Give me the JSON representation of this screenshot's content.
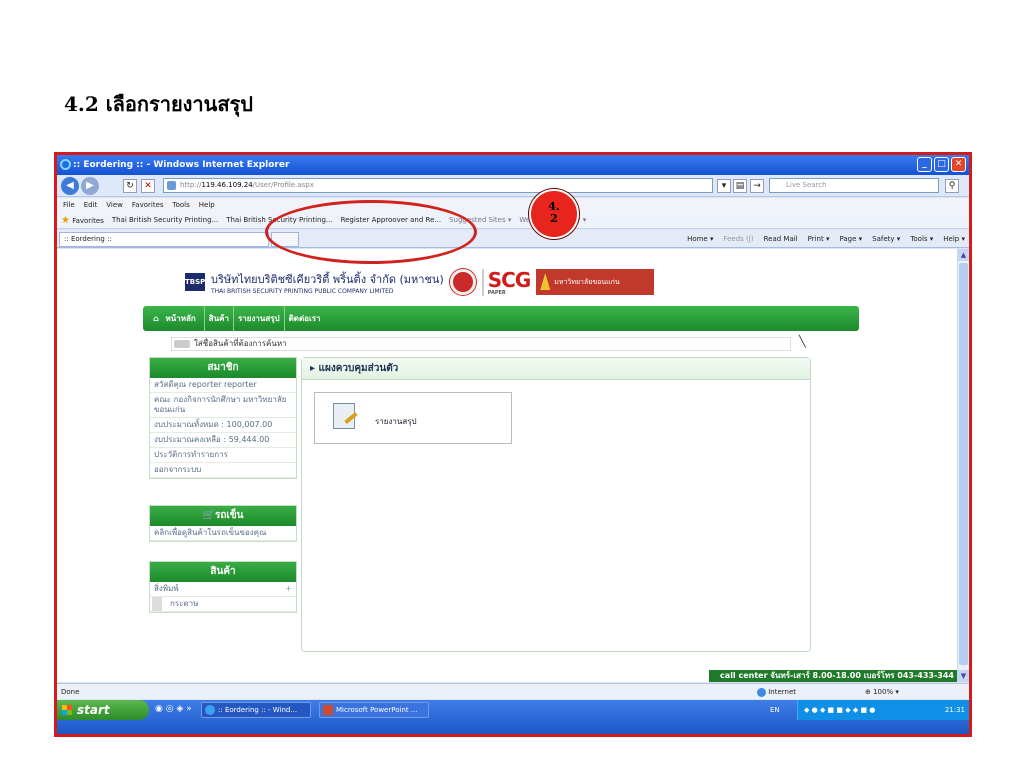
{
  "slide_title": "4.2  เลือกรายงานสรุป",
  "window": {
    "title": ":: Eordering :: - Windows Internet Explorer",
    "minimize": "_",
    "maximize": "□",
    "close": "✕"
  },
  "addressbar": {
    "url_prefix": "http://",
    "url_host": "119.46.109.24",
    "url_path": "/User/Profile.aspx",
    "search_placeholder": "Live Search"
  },
  "menu": [
    "File",
    "Edit",
    "View",
    "Favorites",
    "Tools",
    "Help"
  ],
  "favorites": {
    "label": "Favorites",
    "items": [
      "Thai British Security Printing...",
      "Thai British Security Printing...",
      "Register Approover and Re...",
      "Suggested Sites ▾",
      "Web Slice Gallery ▾"
    ]
  },
  "tab": {
    "label": ":: Eordering ::"
  },
  "commands": [
    "Home ▾",
    "Feeds (J)",
    "Read Mail",
    "Print ▾",
    "Page ▾",
    "Safety ▾",
    "Tools ▾",
    "Help ▾"
  ],
  "site": {
    "company_th": "บริษัทไทยบริติชซีเคียวริตี้ พริ้นติ้ง จำกัด (มหาชน)",
    "company_en": "THAI BRITISH SECURITY PRINTING PUBLIC COMPANY LIMITED",
    "tbsp_logo": "TBSP",
    "scg_logo": "SCG",
    "scg_sub": "PAPER",
    "kku_logo": "มหาวิทยาลัยขอนแก่น",
    "nav": [
      "หน้าหลัก",
      "สินค้า",
      "รายงานสรุป",
      "ติดต่อเรา"
    ],
    "search_placeholder": "ใส่ชื่อสินค้าที่ต้องการค้นหา",
    "member": {
      "header": "สมาชิก",
      "items": [
        "สวัสดีคุณ reporter reporter",
        "คณะ กองกิจการนักศึกษา มหาวิทยาลัยขอนแก่น",
        "งบประมาณทั้งหมด : 100,007.00",
        "งบประมาณคงเหลือ : 59,444.00",
        "ประวัติการทำรายการ",
        "ออกจากระบบ"
      ]
    },
    "cart": {
      "header": "รถเข็น",
      "items": [
        "คลิกเพื่อดูสินค้าในรถเข็นของคุณ"
      ]
    },
    "products": {
      "header": "สินค้า",
      "category": "สิ่งพิมพ์",
      "plus": "+",
      "sub": "กระดาษ"
    },
    "panel_title": "แผงควบคุมส่วนตัว",
    "report_label": "รายงานสรุป",
    "callcenter": "call center จันทร์-เสาร์ 8.00-18.00 เบอร์โทร 043-433-344"
  },
  "annotation": "4.\n2",
  "status": {
    "text": "Done",
    "zone": "Internet",
    "zoom": "100%"
  },
  "taskbar": {
    "start": "start",
    "tasks": [
      ":: Eordering :: - Wind...",
      "Microsoft PowerPoint ..."
    ],
    "lang": "EN",
    "clock": "21:31"
  }
}
